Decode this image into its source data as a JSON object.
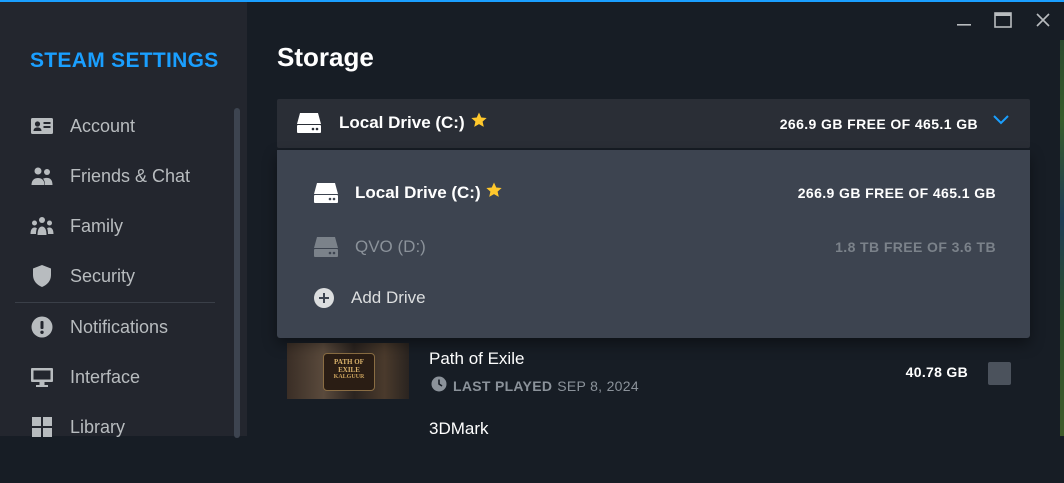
{
  "window": {
    "controls": [
      "minimize-icon",
      "maximize-icon",
      "close-icon"
    ]
  },
  "sidebar": {
    "title": "STEAM SETTINGS",
    "items": [
      {
        "label": "Account",
        "icon": "account-card-icon"
      },
      {
        "label": "Friends & Chat",
        "icon": "friends-icon"
      },
      {
        "label": "Family",
        "icon": "family-icon"
      },
      {
        "label": "Security",
        "icon": "shield-icon"
      },
      {
        "label": "Notifications",
        "icon": "alert-icon"
      },
      {
        "label": "Interface",
        "icon": "monitor-icon"
      },
      {
        "label": "Library",
        "icon": "library-grid-icon"
      }
    ]
  },
  "main": {
    "title": "Storage",
    "selected_drive": {
      "name": "Local Drive (C:)",
      "space": "266.9 GB FREE OF 465.1 GB",
      "is_default": true
    },
    "dropdown": {
      "options": [
        {
          "name": "Local Drive (C:)",
          "space": "266.9 GB FREE OF 465.1 GB",
          "is_default": true
        },
        {
          "name": "QVO (D:)",
          "space": "1.8 TB FREE OF 3.6 TB",
          "is_default": false
        }
      ],
      "add_label": "Add Drive"
    },
    "games": [
      {
        "name": "Path of Exile",
        "last_played_label": "LAST PLAYED",
        "last_played_date": "SEP 8, 2024",
        "size": "40.78 GB",
        "thumb_logo_text": "PATH OF EXILE",
        "thumb_sub_text": "KALGUUR"
      },
      {
        "name": "3DMark"
      }
    ]
  },
  "colors": {
    "accent": "#1a9fff",
    "star": "#ffc82c",
    "sidebar_bg": "#23262e",
    "main_bg": "#171d25",
    "dropdown_bg": "#3d4450"
  }
}
